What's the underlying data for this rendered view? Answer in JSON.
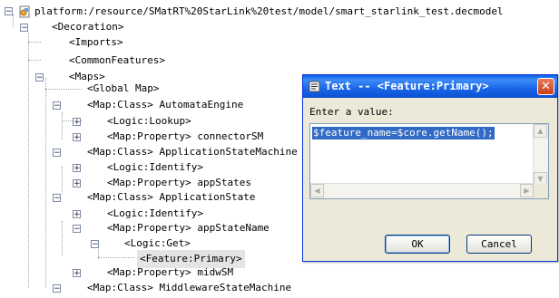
{
  "tree": {
    "root": "platform:/resource/SMatRT%20StarLink%20test/model/smart_starlink_test.decmodel",
    "decoration": "<Decoration>",
    "imports": "<Imports>",
    "common_features": "<CommonFeatures>",
    "maps": "<Maps>",
    "global_map": "<Global Map>",
    "map_automata_engine": "<Map:Class> AutomataEngine",
    "logic_lookup": "<Logic:Lookup>",
    "map_prop_connector": "<Map:Property> connectorSM",
    "map_app_state_machine": "<Map:Class> ApplicationStateMachine",
    "logic_identify_1": "<Logic:Identify>",
    "map_prop_appstates": "<Map:Property> appStates",
    "map_app_state": "<Map:Class> ApplicationState",
    "logic_identify_2": "<Logic:Identify>",
    "map_prop_appstatename": "<Map:Property> appStateName",
    "logic_get": "<Logic:Get>",
    "feature_primary": "<Feature:Primary>",
    "map_prop_midwsm": "<Map:Property> midwSM",
    "map_middleware": "<Map:Class> MiddlewareStateMachine"
  },
  "dialog": {
    "title": "Text -- <Feature:Primary>",
    "prompt": "Enter a value:",
    "value": "$feature_name=$core.getName();",
    "ok_label": "OK",
    "cancel_label": "Cancel",
    "close_glyph": "✕"
  },
  "glyphs": {
    "collapse": "−",
    "expand": "+"
  },
  "icons": [
    "model-file-icon",
    "text-dialog-icon",
    "close-icon"
  ]
}
